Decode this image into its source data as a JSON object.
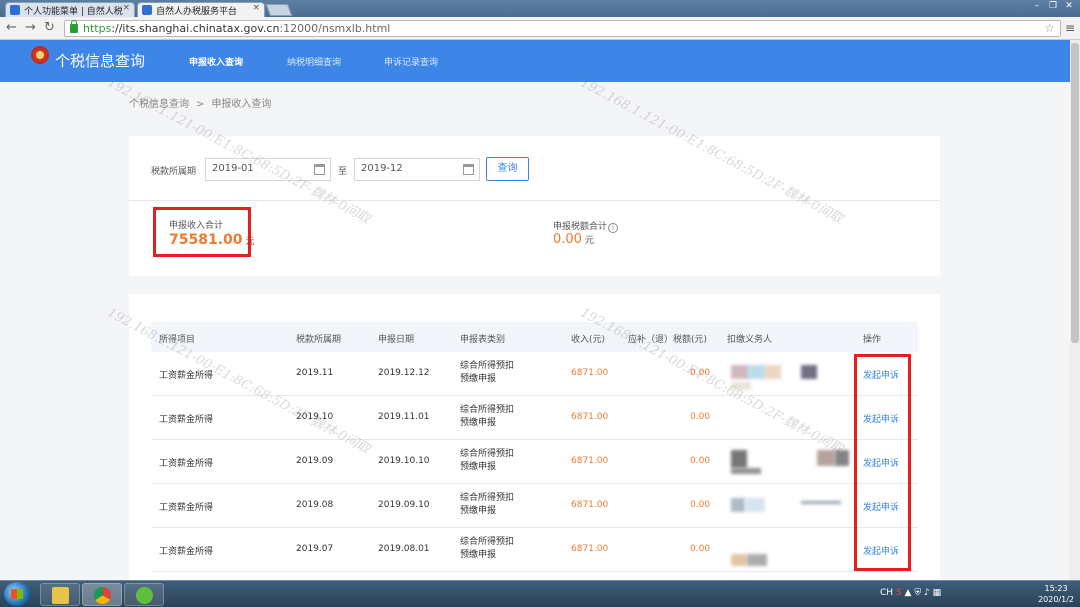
{
  "browser": {
    "tabs": [
      {
        "title": "个人功能菜单 | 自然人税"
      },
      {
        "title": "自然人办税服务平台"
      }
    ],
    "url_scheme": "https",
    "url_host": "://its.shanghai.chinatax.gov.cn",
    "url_rest": ":12000/nsmxlb.html"
  },
  "header": {
    "site_title": "个税信息查询",
    "nav": [
      "申报收入查询",
      "纳税明细查询",
      "申诉记录查询"
    ]
  },
  "breadcrumb": {
    "root": "个税信息查询",
    "separator": ">",
    "current": "申报收入查询"
  },
  "filter": {
    "period_label": "税款所属期",
    "start": "2019-01",
    "to_label": "至",
    "end": "2019-12",
    "query_button": "查询"
  },
  "summary": {
    "income_label": "申报收入合计",
    "income_value": "75581.00",
    "income_unit": "元",
    "tax_label": "申报税额合计",
    "tax_value": "0.00",
    "tax_unit": "元"
  },
  "table": {
    "headers": [
      "所得项目",
      "税款所属期",
      "申报日期",
      "申报表类别",
      "收入(元)",
      "应补（退）税额(元)",
      "扣缴义务人",
      "操作"
    ],
    "rows": [
      {
        "item": "工资薪金所得",
        "period": "2019.11",
        "date": "2019.12.12",
        "type_line1": "综合所得预扣",
        "type_line2": "预缴申报",
        "income": "6871.00",
        "tax": "0.00",
        "action": "发起申诉"
      },
      {
        "item": "工资薪金所得",
        "period": "2019.10",
        "date": "2019.11.01",
        "type_line1": "综合所得预扣",
        "type_line2": "预缴申报",
        "income": "6871.00",
        "tax": "0.00",
        "action": "发起申诉"
      },
      {
        "item": "工资薪金所得",
        "period": "2019.09",
        "date": "2019.10.10",
        "type_line1": "综合所得预扣",
        "type_line2": "预缴申报",
        "income": "6871.00",
        "tax": "0.00",
        "action": "发起申诉"
      },
      {
        "item": "工资薪金所得",
        "period": "2019.08",
        "date": "2019.09.10",
        "type_line1": "综合所得预扣",
        "type_line2": "预缴申报",
        "income": "6871.00",
        "tax": "0.00",
        "action": "发起申诉"
      },
      {
        "item": "工资薪金所得",
        "period": "2019.07",
        "date": "2019.08.01",
        "type_line1": "综合所得预扣",
        "type_line2": "预缴申报",
        "income": "6871.00",
        "tax": "0.00",
        "action": "发起申诉"
      }
    ]
  },
  "watermark": "192.168.1.121-00:E1:8C:68:5D:2F-魏林-0间取",
  "taskbar": {
    "apps": [
      "file-explorer-icon",
      "chrome-icon",
      "wechat-icon"
    ],
    "lang": "CH",
    "time": "15:23",
    "date": "2020/1/2"
  },
  "colors": {
    "nav_blue": "#3d86e8",
    "amount_orange": "#ee7b2f",
    "highlight_red": "#e4201c"
  }
}
